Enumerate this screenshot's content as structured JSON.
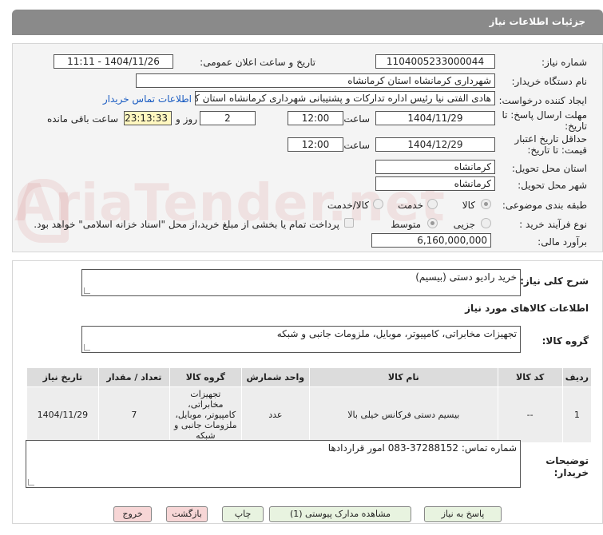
{
  "header": {
    "title": "جزئیات اطلاعات نیاز"
  },
  "watermark": {
    "text": "AriaTender.net"
  },
  "form": {
    "need_number_label": "شماره نیاز:",
    "need_number": "1104005233000044",
    "announce_label": "تاریخ و ساعت اعلان عمومی:",
    "announce_value": "1404/11/26 - 11:11",
    "buyer_org_label": "نام دستگاه خریدار:",
    "buyer_org": "شهرداری کرمانشاه استان کرمانشاه",
    "creator_label": "ایجاد کننده درخواست:",
    "creator": "هادی الفتی نیا رئیس اداره تدارکات و پشتیبانی شهرداری کرمانشاه استان کرمانشاه",
    "contact_link": "اطلاعات تماس خریدار",
    "reply_deadline_label": "مهلت ارسال پاسخ: تا تاریخ:",
    "reply_date": "1404/11/29",
    "time_label": "ساعت",
    "reply_time": "12:00",
    "days_value": "2",
    "days_label": "روز و",
    "remaining_time": "23:13:33",
    "remaining_label": "ساعت باقی مانده",
    "validity_label": "حداقل تاریخ اعتبار قیمت: تا تاریخ:",
    "validity_date": "1404/12/29",
    "validity_time": "12:00",
    "province_label": "استان محل تحویل:",
    "province": "کرمانشاه",
    "city_label": "شهر محل تحویل:",
    "city": "کرمانشاه",
    "category_label": "طبقه بندی موضوعی:",
    "category_options": [
      "کالا",
      "خدمت",
      "کالا/خدمت"
    ],
    "category_selected": "کالا",
    "process_label": "نوع فرآیند خرید :",
    "process_options": [
      "جزیی",
      "متوسط"
    ],
    "process_selected": "متوسط",
    "payment_note": "پرداخت تمام یا بخشی از مبلغ خرید،از محل \"اسناد خزانه اسلامی\" خواهد بود.",
    "budget_label": "برآورد مالی:",
    "budget": "6,160,000,000"
  },
  "details": {
    "summary_label": "شرح کلی نیاز:",
    "summary": "خرید رادیو دستی (بیسیم)",
    "goods_info_title": "اطلاعات کالاهای مورد نیاز",
    "goods_group_label": "گروه کالا:",
    "goods_group": "تجهیزات مخابراتی، کامپیوتر، موبایل، ملزومات جانبی و شبکه",
    "table": {
      "headers": [
        "ردیف",
        "کد کالا",
        "نام کالا",
        "واحد شمارش",
        "گروه کالا",
        "تعداد / مقدار",
        "تاریخ نیاز"
      ],
      "rows": [
        [
          "1",
          "--",
          "بیسیم دستی فرکانس خیلی بالا",
          "عدد",
          "تجهیزات مخابراتی، کامپیوتر، موبایل، ملزومات جانبی و شبکه",
          "7",
          "1404/11/29"
        ]
      ]
    },
    "buyer_notes_label": "توضیحات خریدار:",
    "buyer_notes": "شماره تماس: 37288152-083 امور قراردادها"
  },
  "buttons": {
    "reply": "پاسخ به نیاز",
    "view_docs": "مشاهده مدارک پیوستی (1)",
    "print": "چاپ",
    "back": "بازگشت",
    "exit": "خروج"
  }
}
